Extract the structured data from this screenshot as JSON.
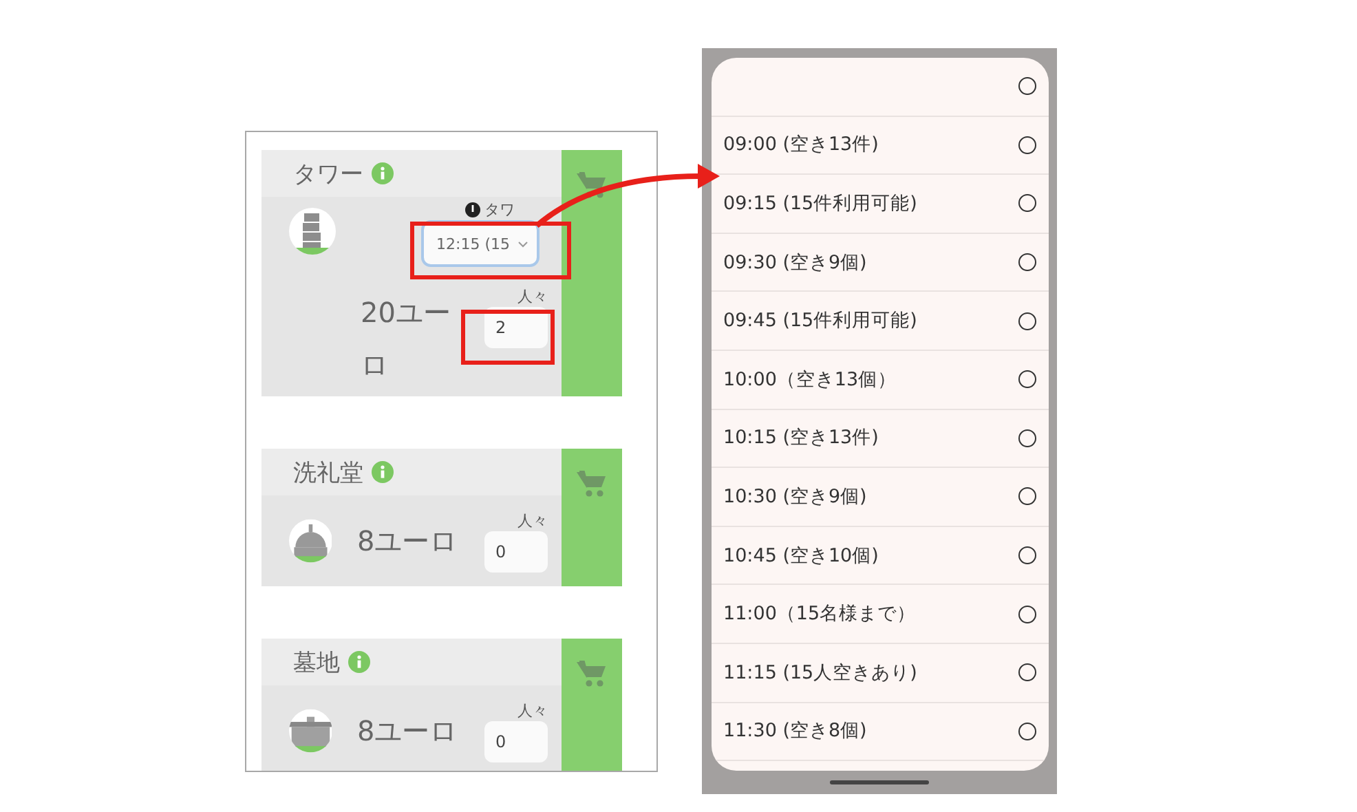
{
  "tickets": [
    {
      "kind": "timed",
      "title": "タワー",
      "time_label": "タワ",
      "time_value": "12:15 (15",
      "price": "20ユーロ",
      "people_label": "人々",
      "people_value": "2"
    },
    {
      "kind": "simple",
      "title": "洗礼堂",
      "price": "8ユーロ",
      "people_label": "人々",
      "people_value": "0"
    },
    {
      "kind": "simple",
      "title": "墓地",
      "price": "8ユーロ",
      "people_label": "人々",
      "people_value": "0"
    }
  ],
  "time_picker": {
    "options": [
      {
        "selected": false
      },
      {
        "label": "09:00 (空き13件)",
        "selected": false
      },
      {
        "label": "09:15 (15件利用可能)",
        "selected": false
      },
      {
        "label": "09:30 (空き9個)",
        "selected": false
      },
      {
        "label": "09:45 (15件利用可能)",
        "selected": false
      },
      {
        "label": "10:00（空き13個）",
        "selected": false
      },
      {
        "label": "10:15 (空き13件)",
        "selected": false
      },
      {
        "label": "10:30 (空き9個)",
        "selected": false
      },
      {
        "label": "10:45 (空き10個)",
        "selected": false
      },
      {
        "label": "11:00（15名様まで）",
        "selected": false
      },
      {
        "label": "11:15 (15人空きあり)",
        "selected": false
      },
      {
        "label": "11:30 (空き8個)",
        "selected": false
      }
    ]
  }
}
